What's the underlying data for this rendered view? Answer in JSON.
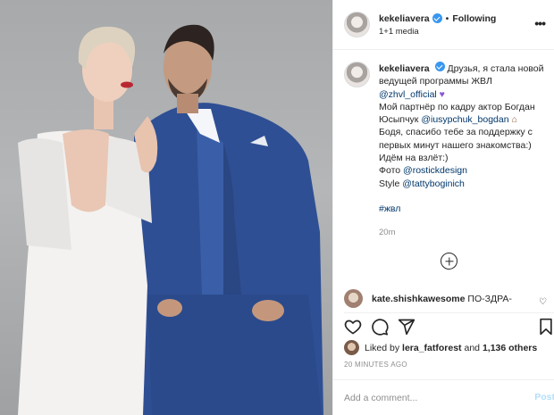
{
  "post_author": {
    "username": "kekeliavera",
    "follow_state": "Following",
    "media_count": "1+1 media"
  },
  "caption": {
    "username": "kekeliavera",
    "lines": [
      "Друзья, я стала новой",
      "ведущей программы ЖВЛ"
    ],
    "mention_zhvl": "@zhvl_official",
    "line3": "Мой партнёр по кадру актор Богдан",
    "line4a": "Юсыпчук",
    "mention_bogdan": "@iusypchuk_bogdan",
    "line5": "Бодя, спасибо тебе за поддержку с",
    "line6": "первых минут нашего знакомства:)",
    "line7": "Идём на взлёт:)",
    "photo_label": "Фото",
    "mention_photo": "@rostickdesign",
    "style_label": "Style",
    "mention_style": "@tattyboginich",
    "hashtag": "#жвл",
    "age": "20m"
  },
  "comment": {
    "username": "kate.shishkawesome",
    "text": "ПО-ЗДРА-"
  },
  "likes": {
    "prefix": "Liked by",
    "user": "lera_fatforest",
    "conjunction": "and",
    "others": "1,136 others"
  },
  "timestamp": "20 MINUTES AGO",
  "add_comment": {
    "placeholder": "Add a comment...",
    "post_label": "Post"
  },
  "colors": {
    "link": "#00376b",
    "verified": "#3897f0",
    "muted": "#8e8e8e",
    "post_disabled": "#b2dffc"
  },
  "icons": [
    "heart-icon",
    "comment-icon",
    "share-icon",
    "bookmark-icon",
    "more-options-icon",
    "add-circle-icon",
    "verified-badge-icon"
  ]
}
